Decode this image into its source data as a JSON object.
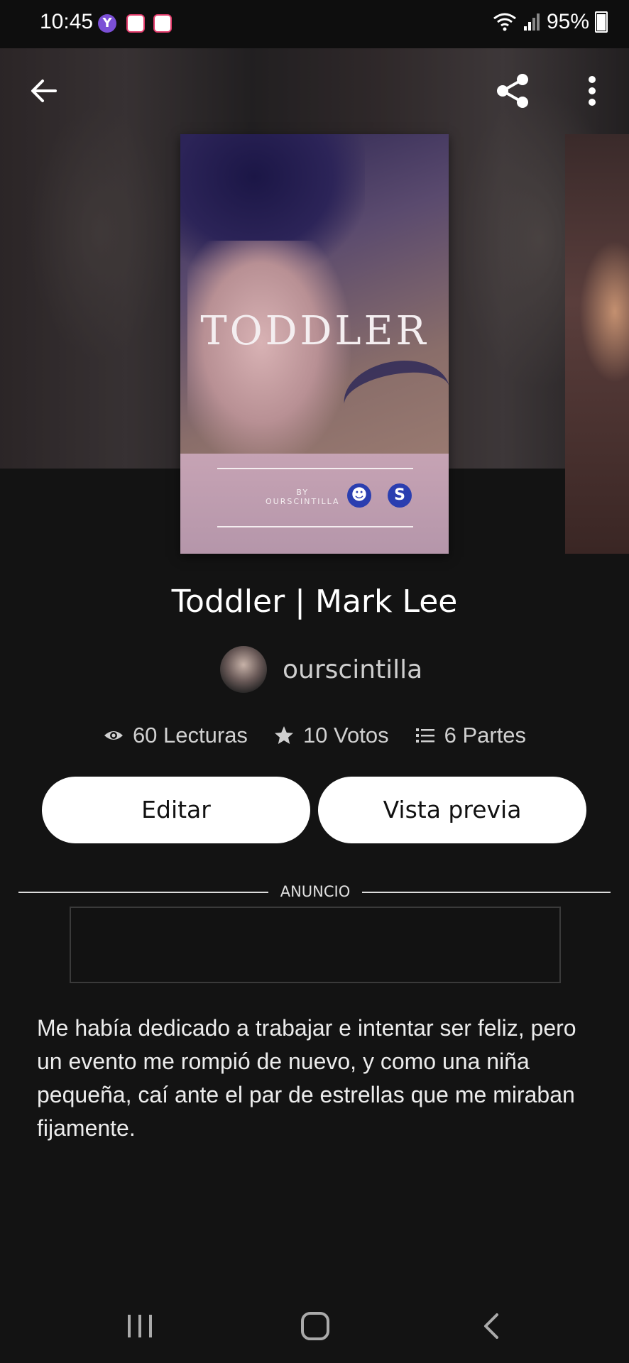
{
  "status_bar": {
    "time": "10:45",
    "battery": "95%"
  },
  "story": {
    "cover_title": "TODDLER",
    "cover_by": "BY",
    "cover_author": "OURSCINTILLA",
    "title": "Toddler | Mark Lee",
    "author": "ourscintilla",
    "stats": {
      "reads": "60 Lecturas",
      "votes": "10 Votos",
      "parts": "6 Partes"
    },
    "description": "Me había dedicado a trabajar e intentar ser feliz, pero un evento me rompió de nuevo, y como una niña pequeña, caí ante el par de estrellas que me miraban fijamente."
  },
  "buttons": {
    "edit": "Editar",
    "preview": "Vista previa"
  },
  "ad": {
    "label": "ANUNCIO"
  },
  "icons": {
    "back": "back-arrow-icon",
    "share": "share-icon",
    "more": "more-vert-icon",
    "reads": "eye-icon",
    "votes": "star-icon",
    "parts": "list-icon"
  },
  "colors": {
    "background": "#131313",
    "button_bg": "#ffffff"
  }
}
